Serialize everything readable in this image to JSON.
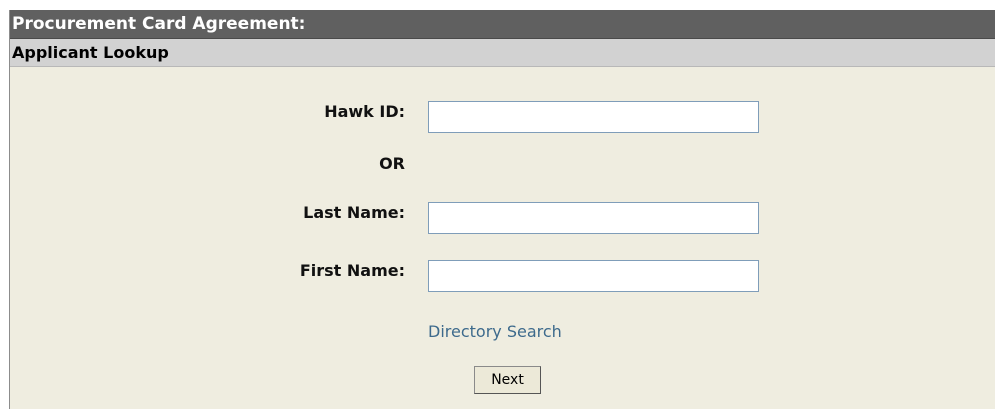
{
  "window": {
    "title": "Procurement Card Agreement:"
  },
  "section": {
    "title": "Applicant Lookup"
  },
  "form": {
    "hawk_id_label": "Hawk ID:",
    "hawk_id_value": "",
    "or_label": "OR",
    "last_name_label": "Last Name:",
    "last_name_value": "",
    "first_name_label": "First Name:",
    "first_name_value": "",
    "directory_search_link": "Directory Search",
    "next_button": "Next"
  },
  "colors": {
    "title_bar_bg": "#606060",
    "section_bar_bg": "#d2d2d2",
    "form_bg": "#efede0",
    "link": "#3d6a8c",
    "input_border": "#7f9db9"
  }
}
